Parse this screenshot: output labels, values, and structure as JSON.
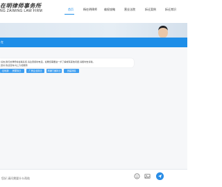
{
  "header": {
    "logo_cn": "在明律师事务所",
    "logo_en": "NG ZAIMING LAW FIRM",
    "nav": [
      {
        "label": "首页",
        "active": true
      },
      {
        "label": "杨在明律师",
        "active": false
      },
      {
        "label": "维权攻略",
        "active": false
      },
      {
        "label": "营业法院",
        "active": false
      },
      {
        "label": "拆迁案例",
        "active": false
      },
      {
        "label": "拆迁常识",
        "active": false
      }
    ]
  },
  "chat": {
    "panel_title": "在",
    "message_lines": [
      "好的,我们的律师将会联系您,请注意接听电话。如果您需要进一步了解或有其他问题,请随时告诉我。",
      "您好,欢迎咨询,马上为您服务"
    ],
    "quick_replies": [
      "征地拆迁",
      "房屋拆迁",
      "厂房企业拆迁",
      "商铺门面拆迁",
      "违建拆除"
    ],
    "input_placeholder": "您好,请问需要什么帮助"
  },
  "icons": {
    "emoji": "emoji-icon",
    "image": "image-icon",
    "send": "send-icon"
  },
  "colors": {
    "accent": "#1e8ee8",
    "chip": "#3e9ef0",
    "chat_bg": "#f6f7f9"
  }
}
